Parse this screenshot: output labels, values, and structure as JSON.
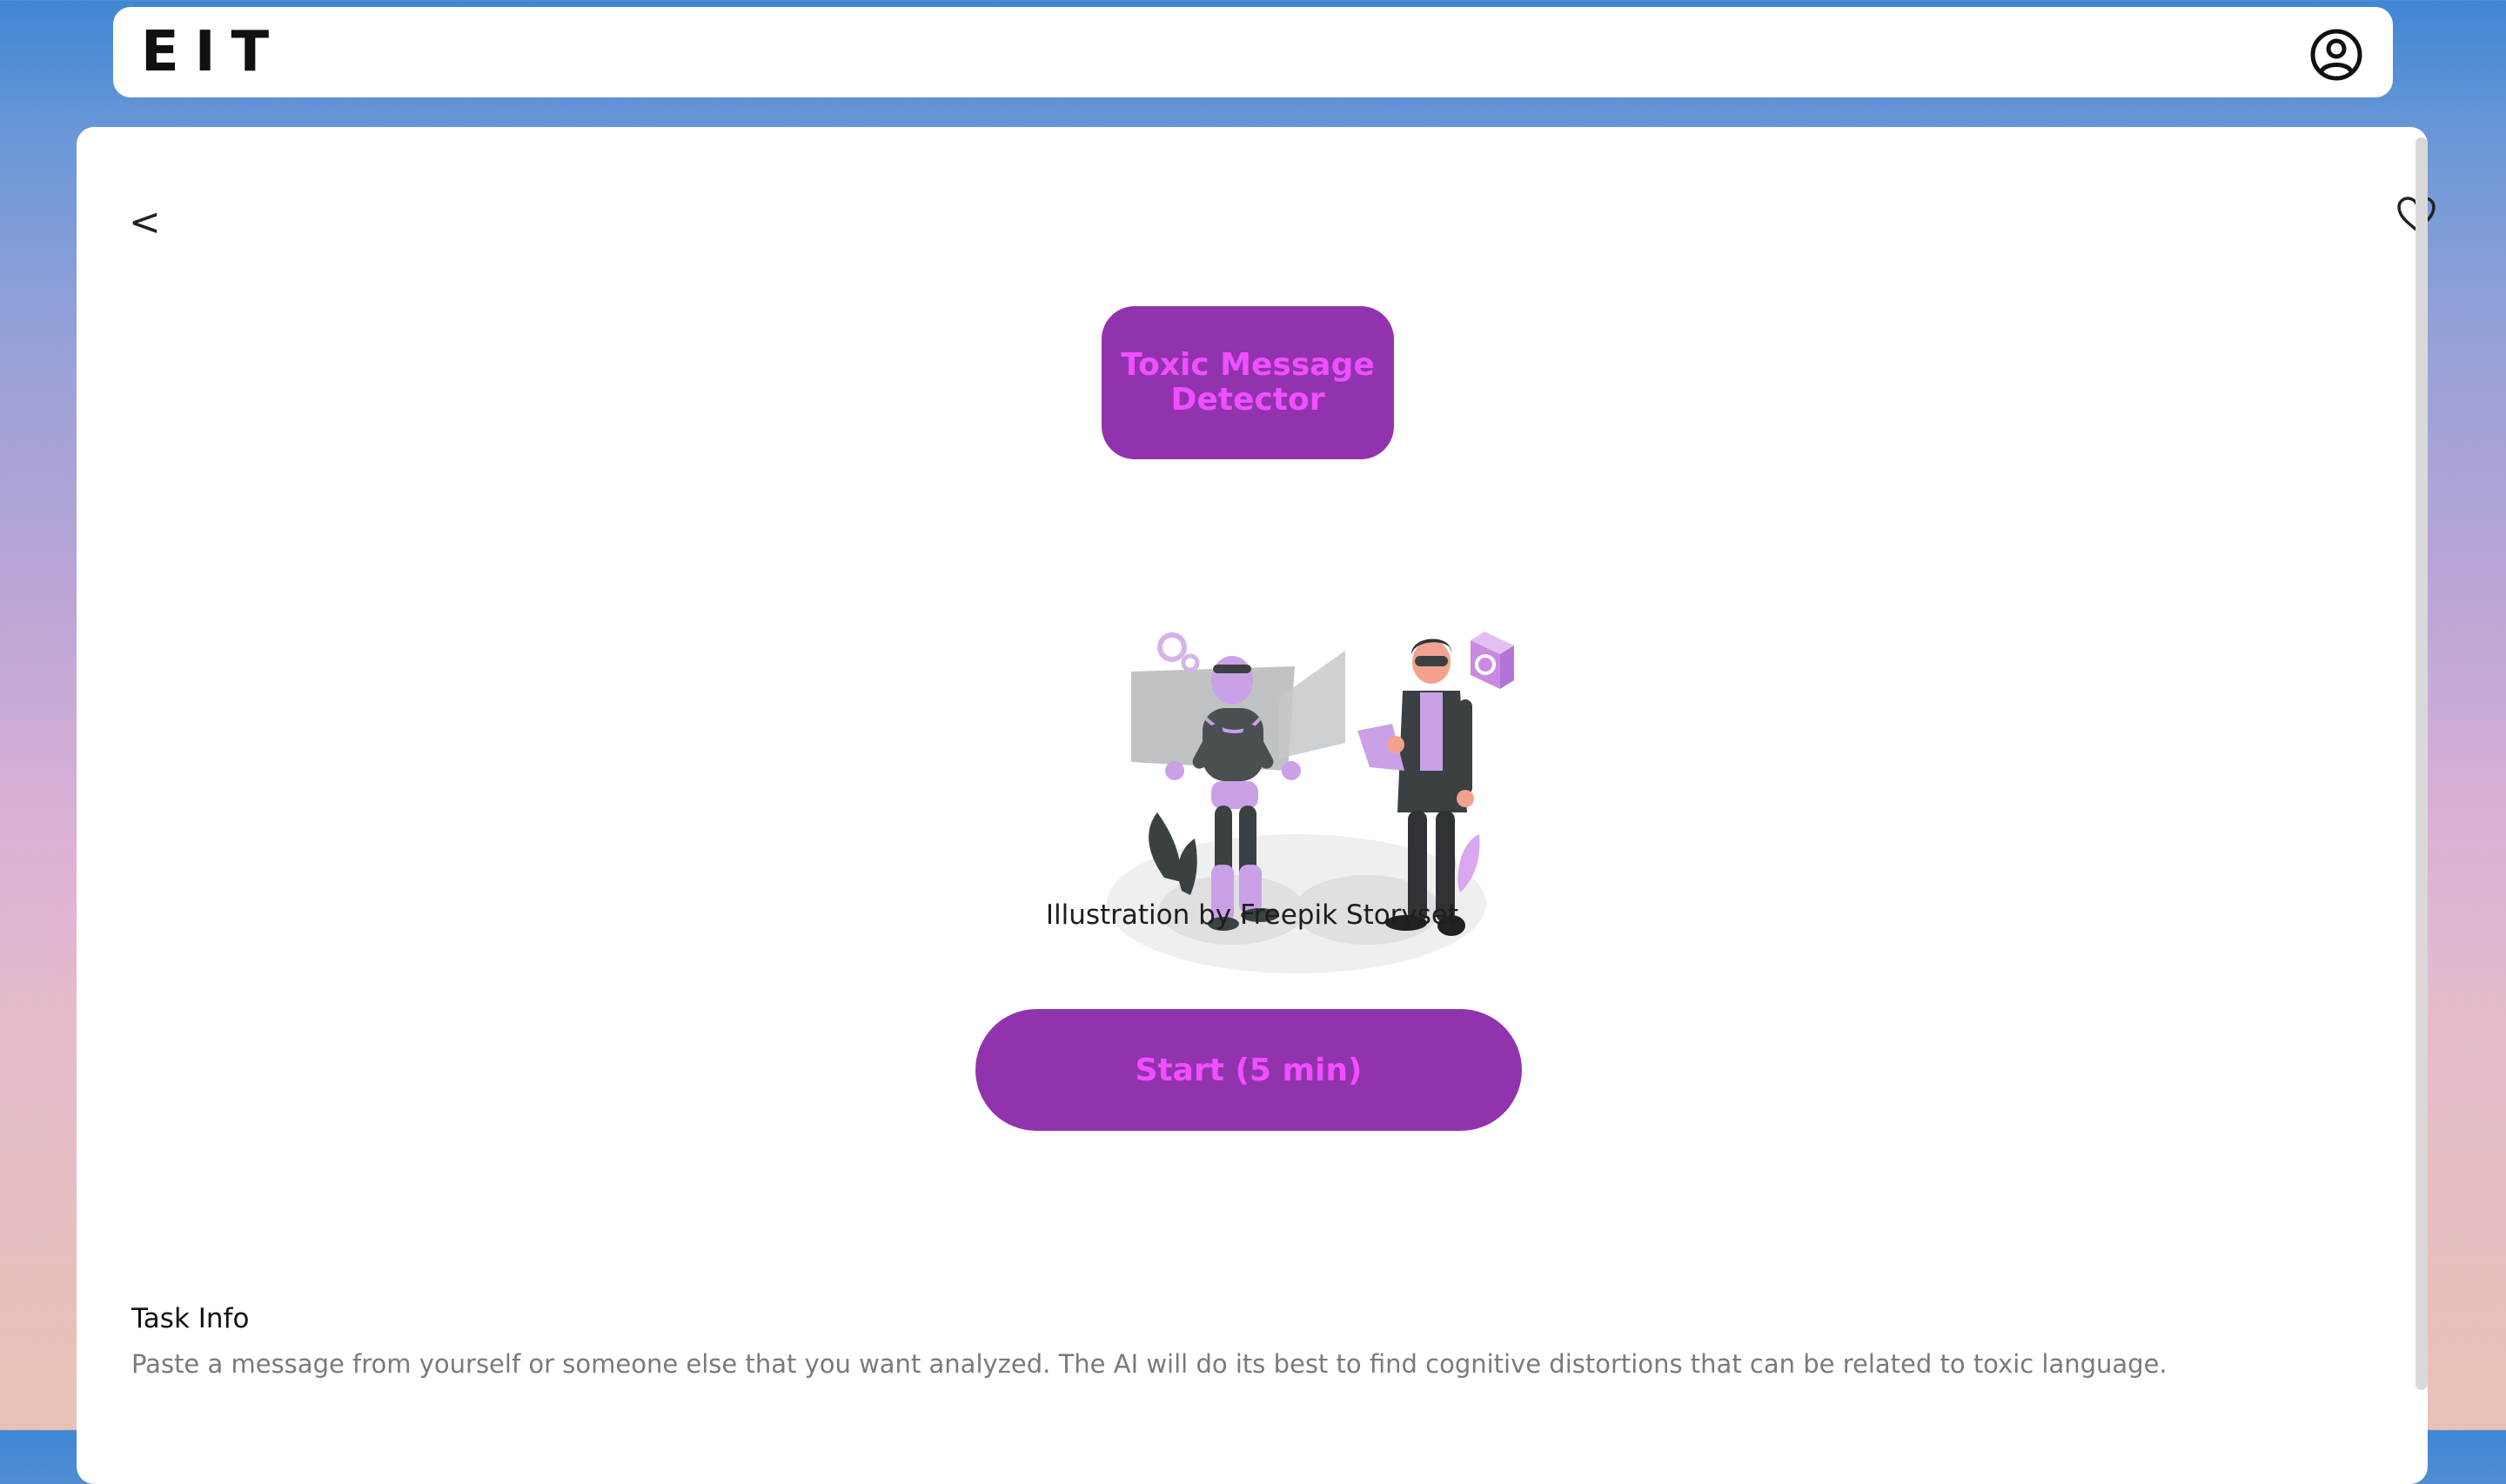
{
  "header": {
    "logo": "EIT",
    "account_icon": "user-circle-icon"
  },
  "nav": {
    "back_label": "<",
    "favorite_icon": "heart-icon"
  },
  "tool": {
    "title": "Toxic Message Detector",
    "illustration_credit": "Illustration by Freepik Storyset",
    "start_label": "Start (5 min)"
  },
  "task_info": {
    "heading": "Task Info",
    "description": "Paste a message from yourself or someone else that you want analyzed. The AI will do its best to find cognitive distortions that can be related to toxic language."
  },
  "colors": {
    "accent": "#9133ad",
    "accent_text": "#f04fff"
  }
}
